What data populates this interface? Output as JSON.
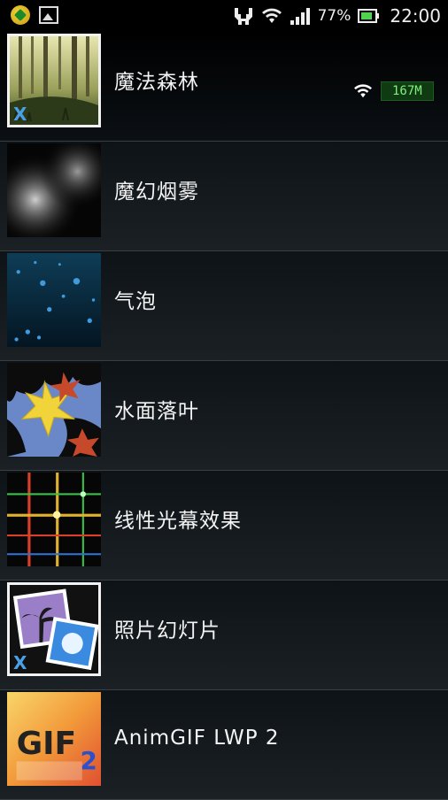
{
  "status_bar": {
    "battery_percent": "77%",
    "time": "22:00",
    "icons": [
      "app-notification-icon",
      "image-notification-icon",
      "usb-icon",
      "wifi-icon",
      "signal-icon",
      "battery-icon"
    ]
  },
  "overlay": {
    "wifi_icon": "wifi-icon",
    "memory": "167M"
  },
  "wallpapers": [
    {
      "label": "魔法森林",
      "badge": "X"
    },
    {
      "label": "魔幻烟雾"
    },
    {
      "label": "气泡"
    },
    {
      "label": "水面落叶"
    },
    {
      "label": "线性光幕效果"
    },
    {
      "label": "照片幻灯片",
      "badge": "X"
    },
    {
      "label": "AnimGIF LWP 2"
    }
  ],
  "colors": {
    "background": "#000000",
    "badge_blue": "#49a0e6",
    "memory_green": "#7ff07f"
  }
}
